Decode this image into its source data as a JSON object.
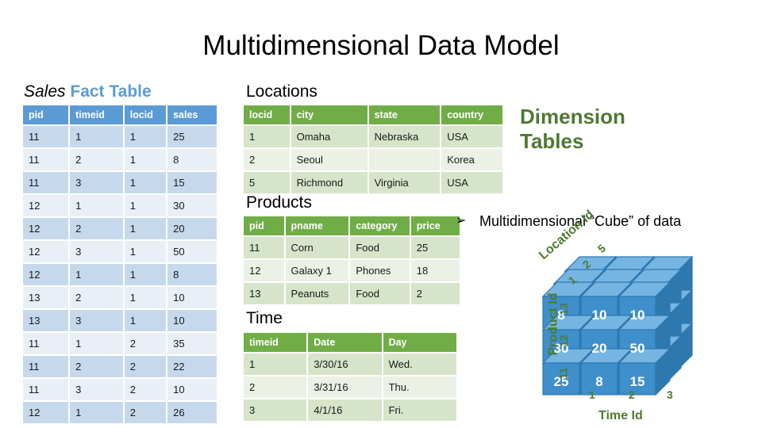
{
  "slide": {
    "title": "Multidimensional Data Model"
  },
  "fact_table": {
    "caption_italic": "Sales",
    "caption_blue": "Fact Table",
    "headers": [
      "pid",
      "timeid",
      "locid",
      "sales"
    ],
    "rows": [
      [
        "11",
        "1",
        "1",
        "25"
      ],
      [
        "11",
        "2",
        "1",
        "8"
      ],
      [
        "11",
        "3",
        "1",
        "15"
      ],
      [
        "12",
        "1",
        "1",
        "30"
      ],
      [
        "12",
        "2",
        "1",
        "20"
      ],
      [
        "12",
        "3",
        "1",
        "50"
      ],
      [
        "12",
        "1",
        "1",
        "8"
      ],
      [
        "13",
        "2",
        "1",
        "10"
      ],
      [
        "13",
        "3",
        "1",
        "10"
      ],
      [
        "11",
        "1",
        "2",
        "35"
      ],
      [
        "11",
        "2",
        "2",
        "22"
      ],
      [
        "11",
        "3",
        "2",
        "10"
      ],
      [
        "12",
        "1",
        "2",
        "26"
      ]
    ]
  },
  "locations_table": {
    "caption": "Locations",
    "headers": [
      "locid",
      "city",
      "state",
      "country"
    ],
    "rows": [
      [
        "1",
        "Omaha",
        "Nebraska",
        "USA"
      ],
      [
        "2",
        "Seoul",
        "",
        "Korea"
      ],
      [
        "5",
        "Richmond",
        "Virginia",
        "USA"
      ]
    ]
  },
  "products_table": {
    "caption": "Products",
    "headers": [
      "pid",
      "pname",
      "category",
      "price"
    ],
    "rows": [
      [
        "11",
        "Corn",
        "Food",
        "25"
      ],
      [
        "12",
        "Galaxy 1",
        "Phones",
        "18"
      ],
      [
        "13",
        "Peanuts",
        "Food",
        "2"
      ]
    ]
  },
  "time_table": {
    "caption": "Time",
    "headers": [
      "timeid",
      "Date",
      "Day"
    ],
    "rows": [
      [
        "1",
        "3/30/16",
        "Wed."
      ],
      [
        "2",
        "3/31/16",
        "Thu."
      ],
      [
        "3",
        "4/1/16",
        "Fri."
      ]
    ]
  },
  "dimension_heading": {
    "line1": "Dimension",
    "line2": "Tables"
  },
  "cube_bullet": {
    "bullet_glyph": "➢",
    "text": "Multidimensional “Cube” of data"
  },
  "chart_data": {
    "type": "heatmap",
    "title": "Multidimensional “Cube” of data",
    "xlabel": "Time Id",
    "ylabel": "Product Id",
    "zlabel": "Location Id",
    "x_ticks": [
      "1",
      "2",
      "3"
    ],
    "y_ticks": [
      "13",
      "12",
      "11"
    ],
    "z_ticks": [
      "1",
      "2",
      "5"
    ],
    "front_face_rows": [
      {
        "product_id": "13",
        "values": [
          "8",
          "10",
          "10"
        ]
      },
      {
        "product_id": "12",
        "values": [
          "30",
          "20",
          "50"
        ]
      },
      {
        "product_id": "11",
        "values": [
          "25",
          "8",
          "15"
        ]
      }
    ],
    "cell_face_color": "#3E8FCC",
    "cell_top_color": "#76B5E2",
    "cell_side_color": "#2E78B0",
    "label_color": "#4E7A30"
  },
  "colors": {
    "fact_header": "#5B9BD5",
    "fact_row_dark": "#C6D9EC",
    "fact_row_light": "#E9EFF7",
    "dim_header": "#70AD47",
    "dim_row_dark": "#D6E4C9",
    "dim_row_light": "#EBF1E5",
    "dimension_text": "#4E7A30"
  }
}
